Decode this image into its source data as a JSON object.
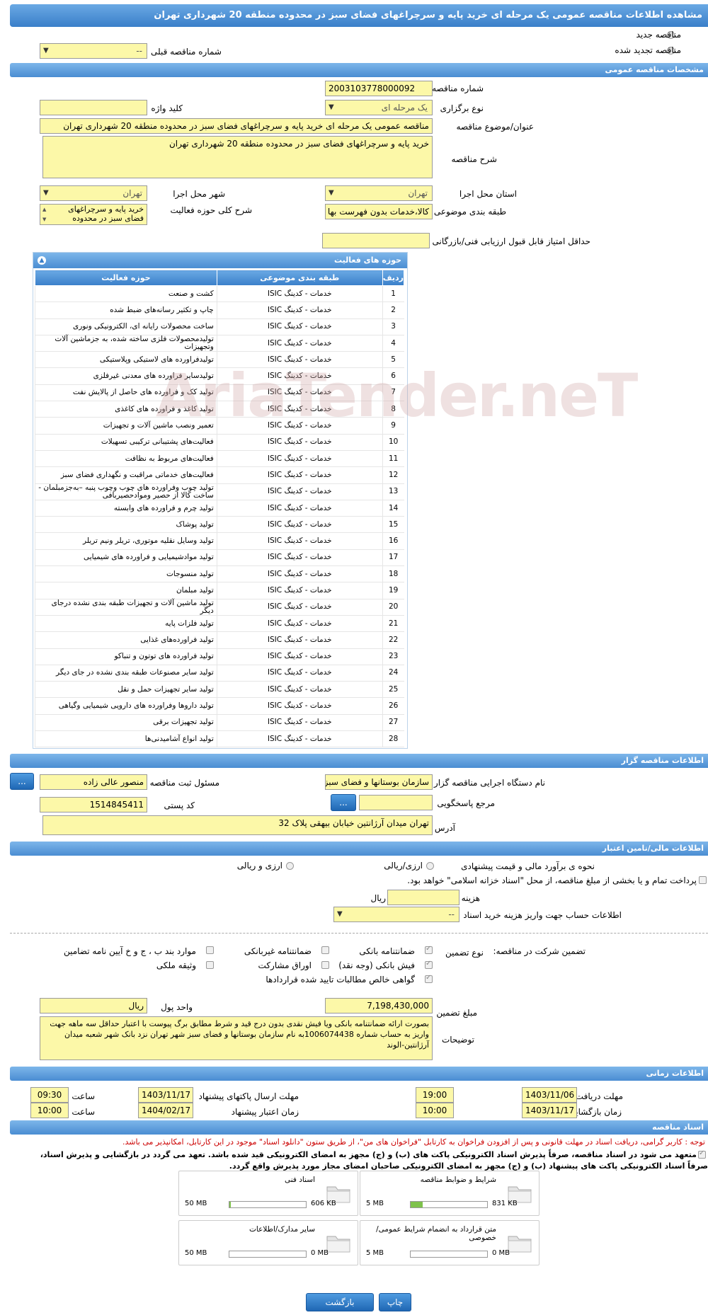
{
  "title": "مشاهده اطلاعات مناقصه عمومی یک مرحله ای خرید پایه و سرچراغهای فضای سبز در محدوده منطقه 20 شهرداری تهران",
  "top": {
    "new_tender": "مناقصه جدید",
    "renewed_tender": "مناقصه تجدید شده",
    "prev_number_label": "شماره مناقصه قبلی",
    "prev_number_value": "--"
  },
  "general": {
    "header": "مشخصات مناقصه عمومی",
    "number_label": "شماره مناقصه",
    "number_value": "2003103778000092",
    "hold_type_label": "نوع برگزاری",
    "hold_type_value": "یک مرحله ای",
    "keyword_label": "کلید واژه",
    "subject_label": "عنوان/موضوع مناقصه",
    "subject_value": "مناقصه عمومی یک مرحله ای خرید پایه و سرچراغهای فضای سبز در محدوده منطقه 20 شهرداری تهران",
    "desc_label": "شرح مناقصه",
    "desc_value": "خرید پایه و سرچراغهای فضای سبز در محدوده منطقه 20 شهرداری تهران",
    "province_label": "استان محل اجرا",
    "province_value": "تهران",
    "city_label": "شهر محل اجرا",
    "city_value": "تهران",
    "category_label": "طبقه بندی موضوعی",
    "category_value": "کالا،خدمات بدون فهرست بها",
    "activity_desc_label": "شرح کلی حوزه فعالیت",
    "activity_desc_value": "خرید پایه و سرچراغهای فضای سبز در محدوده",
    "min_score_label": "حداقل امتیاز قابل قبول ارزیابی فنی/بازرگانی"
  },
  "activities": {
    "header": "حوزه های فعالیت",
    "col_row": "ردیف",
    "col_cat": "طبقه بندی موضوعی",
    "col_act": "حوزه فعالیت",
    "rows": [
      [
        "1",
        "خدمات - کدینگ ISIC",
        "کشت و صنعت"
      ],
      [
        "2",
        "خدمات - کدینگ ISIC",
        "چاپ و تکثیر رسانه‌های ضبط شده"
      ],
      [
        "3",
        "خدمات - کدینگ ISIC",
        "ساخت محصولات رایانه ای، الکترونیکی ونوری"
      ],
      [
        "4",
        "خدمات - کدینگ ISIC",
        "تولیدمحصولات فلزی ساخته شده، به جزماشین آلات وتجهیزات"
      ],
      [
        "5",
        "خدمات - کدینگ ISIC",
        "تولیدفراورده های لاستیکی وپلاستیکی"
      ],
      [
        "6",
        "خدمات - کدینگ ISIC",
        "تولیدسایر فراورده های معدنی غیرفلزی"
      ],
      [
        "7",
        "خدمات - کدینگ ISIC",
        "تولید کک و فراورده های حاصل از پالایش نفت"
      ],
      [
        "8",
        "خدمات - کدینگ ISIC",
        "تولید کاغذ و فراورده های کاغذی"
      ],
      [
        "9",
        "خدمات - کدینگ ISIC",
        "تعمیر ونصب ماشین آلات و تجهیزات"
      ],
      [
        "10",
        "خدمات - کدینگ ISIC",
        "فعالیت‌های پشتیبانی ترکیبی تسهیلات"
      ],
      [
        "11",
        "خدمات - کدینگ ISIC",
        "فعالیت‌های مربوط به نظافت"
      ],
      [
        "12",
        "خدمات - کدینگ ISIC",
        "فعالیت‌های خدماتی مراقبت و نگهداری فضای سبز"
      ],
      [
        "13",
        "خدمات - کدینگ ISIC",
        "تولید چوب وفراورده های چوب وچوب پنبه –بەجزمبلمان - ساخت کالا از حصیر وموادحصیربافی"
      ],
      [
        "14",
        "خدمات - کدینگ ISIC",
        "تولید چرم و فراورده های وابسته"
      ],
      [
        "15",
        "خدمات - کدینگ ISIC",
        "تولید پوشاک"
      ],
      [
        "16",
        "خدمات - کدینگ ISIC",
        "تولید وسایل نقلیه موتوری، تریلر ونیم تریلر"
      ],
      [
        "17",
        "خدمات - کدینگ ISIC",
        "تولید موادشیمیایی و فراورده های شیمیایی"
      ],
      [
        "18",
        "خدمات - کدینگ ISIC",
        "تولید منسوجات"
      ],
      [
        "19",
        "خدمات - کدینگ ISIC",
        "تولید مبلمان"
      ],
      [
        "20",
        "خدمات - کدینگ ISIC",
        "تولید ماشین آلات و تجهیزات طبقه بندی نشده درجای دیگر"
      ],
      [
        "21",
        "خدمات - کدینگ ISIC",
        "تولید فلزات پایه"
      ],
      [
        "22",
        "خدمات - کدینگ ISIC",
        "تولید فراورده‌های غذایی"
      ],
      [
        "23",
        "خدمات - کدینگ ISIC",
        "تولید فراورده های توتون و تنباکو"
      ],
      [
        "24",
        "خدمات - کدینگ ISIC",
        "تولید سایر مصنوعات طبقه بندی نشده در جای دیگر"
      ],
      [
        "25",
        "خدمات - کدینگ ISIC",
        "تولید سایر تجهیزات حمل و نقل"
      ],
      [
        "26",
        "خدمات - کدینگ ISIC",
        "تولید داروها وفراورده های دارویی شیمیایی وگیاهی"
      ],
      [
        "27",
        "خدمات - کدینگ ISIC",
        "تولید تجهیزات برقی"
      ],
      [
        "28",
        "خدمات - کدینگ ISIC",
        "تولید انواع آشامیدنی‌ها"
      ]
    ]
  },
  "organizer": {
    "header": "اطلاعات مناقصه گزار",
    "org_label": "نام دستگاه اجرایی مناقصه گزار",
    "org_value": "سازمان بوستانها و فضای سبز",
    "responsible_label": "مسئول ثبت مناقصه",
    "responsible_value": "منصور عالی زاده",
    "ref_label": "مرجع پاسخگویی",
    "postal_label": "کد پستی",
    "postal_value": "1514845411",
    "address_label": "آدرس",
    "address_value": "تهران میدان آرژانتین خیابان بیهقی پلاک 32",
    "btn_dots": "..."
  },
  "finance": {
    "header": "اطلاعات مالی/تامین اعتبار",
    "estimate_label": "نحوه ی برآورد مالی و قیمت پیشنهادی",
    "opt_rial": "ارزی/ریالی",
    "opt_fx": "ارزی و ریالی",
    "payment_note": "پرداخت تمام و یا بخشی از مبلغ مناقصه، از محل \"اسناد خزانه اسلامی\" خواهد بود.",
    "doc_fee_label": "هزینه خرید اسناد",
    "doc_fee_unit": "ریال",
    "account_label": "اطلاعات حساب جهت واریز هزینه خرید اسناد",
    "account_value": "--"
  },
  "guarantee": {
    "label": "تضمین شرکت در مناقصه:",
    "type_label": "نوع تضمین",
    "bank": "ضمانتنامه بانکی",
    "nonbank": "ضمانتنامه غیربانکی",
    "clauses": "موارد بند ب ، ج و خ آیین نامه تضامین",
    "cheque": "فیش بانکی (وجه نقد)",
    "bonds": "اوراق مشارکت",
    "property": "وثیقه ملکی",
    "claims": "گواهی خالص مطالبات تایید شده قراردادها",
    "amount_label": "مبلغ تضمین",
    "amount_value": "7,198,430,000",
    "unit_label": "واحد پول",
    "unit_value": "ریال",
    "notes_label": "توضیحات",
    "notes_value": "بصورت ارائه ضمانتنامه بانکی ویا فیش نقدی بدون درج قید و شرط مطابق برگ پیوست با اعتبار حداقل سه ماهه جهت واریز به حساب شماره 1006074438به نام سازمان بوستانها و فضای سبز شهر تهران نزد بانک شهر شعبه میدان آرژانتین-الوند"
  },
  "schedule": {
    "header": "اطلاعات زمانی",
    "receive_label": "مهلت دریافت اسناد",
    "receive_date": "1403/11/06",
    "receive_time": "19:00",
    "send_label": "مهلت ارسال پاکتهای پیشنهاد",
    "send_date": "1403/11/17",
    "send_time": "09:30",
    "open_label": "زمان بازگشایی پاکت ها",
    "open_date": "1403/11/17",
    "open_time": "10:00",
    "valid_label": "زمان اعتبار پیشنهاد",
    "valid_date": "1404/02/17",
    "valid_time": "10:00",
    "time_label": "ساعت"
  },
  "docs": {
    "header": "اسناد مناقصه",
    "notice": "توجه : کاربر گرامی، دریافت اسناد در مهلت قانونی و پس از افزودن فراخوان به کارتابل \"فراخوان های من\"، از طریق ستون \"دانلود اسناد\" موجود در این کارتابل، امکانپذیر می باشد.",
    "commit1": "متعهد می شود در اسناد مناقصه، صرفاً پذیرش اسناد الکترونیکی پاکت های (ب) و (ج) مجهز به امضای الکترونیکی قید شده باشد. تعهد می گردد در بازگشایی و پذیرش اسناد،",
    "commit2": "صرفاً اسناد الکترونیکی پاکت های پیشنهاد (ب) و (ج) مجهز به امضای الکترونیکی صاحبان امضای مجاز مورد پذیرش واقع گردد.",
    "files": [
      {
        "name": "شرایط و ضوابط مناقصه",
        "size": "831 KB",
        "max": "5 MB",
        "fill": 0.16
      },
      {
        "name": "اسناد فنی",
        "size": "606 KB",
        "max": "50 MB",
        "fill": 0.02
      },
      {
        "name": "متن قرارداد به انضمام شرایط عمومی/خصوصی",
        "size": "0 MB",
        "max": "5 MB",
        "fill": 0
      },
      {
        "name": "سایر مدارک/اطلاعات",
        "size": "0 MB",
        "max": "50 MB",
        "fill": 0
      }
    ]
  },
  "buttons": {
    "back": "بازگشت",
    "print": "چاپ"
  },
  "watermark": "AriaTender.neT"
}
